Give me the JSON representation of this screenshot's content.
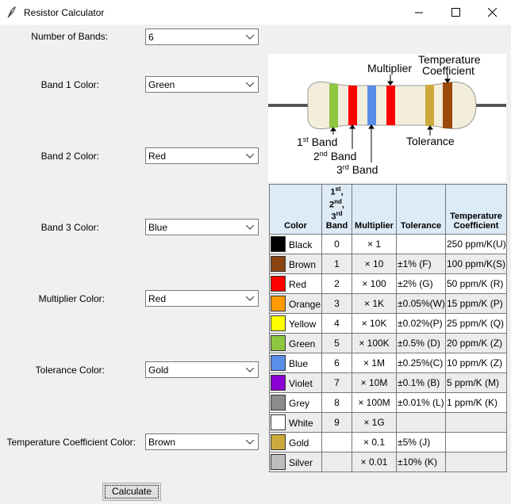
{
  "window": {
    "title": "Resistor Calculator"
  },
  "form": {
    "fields": [
      {
        "label": "Number of Bands:",
        "value": "6"
      },
      {
        "label": "Band 1 Color:",
        "value": "Green"
      },
      {
        "label": "Band 2 Color:",
        "value": "Red"
      },
      {
        "label": "Band 3 Color:",
        "value": "Blue"
      },
      {
        "label": "Multiplier Color:",
        "value": "Red"
      },
      {
        "label": "Tolerance Color:",
        "value": "Gold"
      },
      {
        "label": "Temperature Coefficient Color:",
        "value": "Brown"
      }
    ],
    "calculate_label": "Calculate"
  },
  "diagram": {
    "multiplier": "Multiplier",
    "temp_line1": "Temperature",
    "temp_line2": "Coefficient",
    "band1": "1",
    "band2": "2",
    "band3": "3",
    "sup_st": "st",
    "sup_nd": "nd",
    "sup_rd": "rd",
    "band_word": "Band",
    "tolerance": "Tolerance",
    "band_colors": [
      "#8dc63f",
      "#ff0000",
      "#5a8ee8",
      "#ff0000",
      "#cca93a",
      "#9b4a0b"
    ]
  },
  "table": {
    "headers": {
      "color": "Color",
      "band_l1": "1",
      "band_s1": "st",
      "band_l2": "2",
      "band_s2": "nd",
      "band_l3": "3",
      "band_s3": "rd",
      "band_word": "Band",
      "multiplier": "Multiplier",
      "tolerance": "Tolerance",
      "tc_line1": "Temperature",
      "tc_line2": "Coefficient"
    },
    "rows": [
      {
        "color": "Black",
        "hex": "#000000",
        "band": "0",
        "mult": "× 1",
        "tol": "",
        "tc": "250 ppm/K(U)"
      },
      {
        "color": "Brown",
        "hex": "#8b4513",
        "band": "1",
        "mult": "× 10",
        "tol": "±1% (F)",
        "tc": "100 ppm/K(S)"
      },
      {
        "color": "Red",
        "hex": "#ff0000",
        "band": "2",
        "mult": "× 100",
        "tol": "±2% (G)",
        "tc": "50 ppm/K (R)"
      },
      {
        "color": "Orange",
        "hex": "#ff9a00",
        "band": "3",
        "mult": "× 1K",
        "tol": "±0.05%(W)",
        "tc": "15 ppm/K (P)"
      },
      {
        "color": "Yellow",
        "hex": "#ffff00",
        "band": "4",
        "mult": "× 10K",
        "tol": "±0.02%(P)",
        "tc": "25 ppm/K (Q)"
      },
      {
        "color": "Green",
        "hex": "#8dc63f",
        "band": "5",
        "mult": "× 100K",
        "tol": "±0.5% (D)",
        "tc": "20 ppm/K (Z)"
      },
      {
        "color": "Blue",
        "hex": "#5a8ee8",
        "band": "6",
        "mult": "× 1M",
        "tol": "±0.25%(C)",
        "tc": "10 ppm/K (Z)"
      },
      {
        "color": "Violet",
        "hex": "#8a00d4",
        "band": "7",
        "mult": "× 10M",
        "tol": "±0.1% (B)",
        "tc": "5 ppm/K (M)"
      },
      {
        "color": "Grey",
        "hex": "#8c8c8c",
        "band": "8",
        "mult": "× 100M",
        "tol": "±0.01% (L)",
        "tc": "1 ppm/K (K)"
      },
      {
        "color": "White",
        "hex": "#ffffff",
        "band": "9",
        "mult": "× 1G",
        "tol": "",
        "tc": ""
      },
      {
        "color": "Gold",
        "hex": "#cca93a",
        "band": "",
        "mult": "× 0.1",
        "tol": "±5% (J)",
        "tc": ""
      },
      {
        "color": "Silver",
        "hex": "#bdbdbd",
        "band": "",
        "mult": "× 0.01",
        "tol": "±10% (K)",
        "tc": ""
      }
    ]
  }
}
